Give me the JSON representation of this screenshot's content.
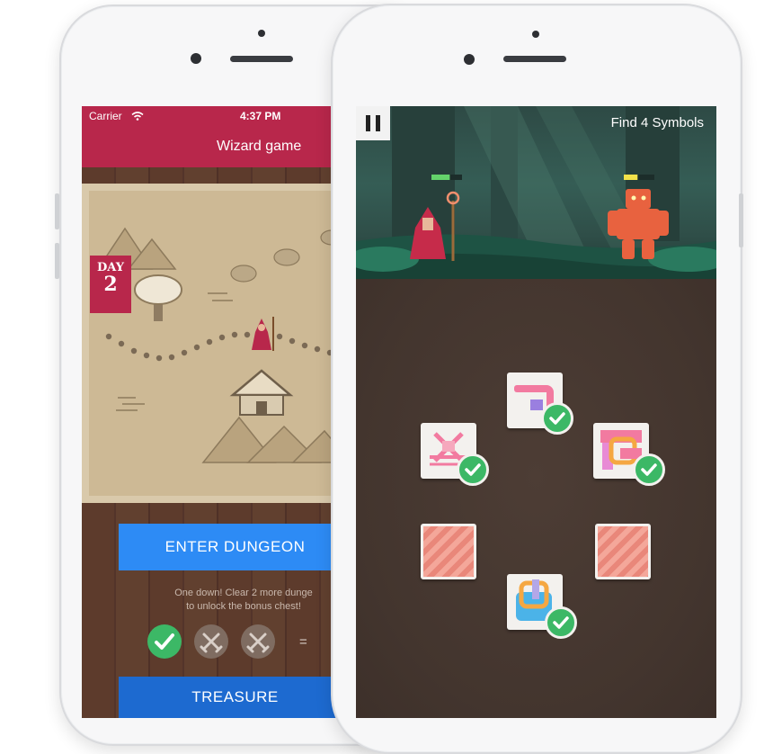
{
  "left_screen": {
    "status": {
      "carrier": "Carrier",
      "time": "4:37 PM"
    },
    "nav_title": "Wizard game",
    "day_badge": {
      "label": "DAY",
      "number": "2"
    },
    "enter_dungeon_label": "ENTER DUNGEON",
    "progress_text_line1": "One down! Clear 2 more dunge",
    "progress_text_line2": "to unlock the bonus chest!",
    "dungeon_badges": [
      {
        "icon": "checkmark-icon",
        "state": "cleared"
      },
      {
        "icon": "crossed-swords-icon",
        "state": "locked"
      },
      {
        "icon": "crossed-swords-icon",
        "state": "locked"
      }
    ],
    "equals_sign": "=",
    "treasure_label": "TREASURE",
    "colors": {
      "brand_red": "#b8274b",
      "enter_blue": "#2d8bf5",
      "treasure_blue": "#1d6ad0",
      "success_green": "#3cb866"
    }
  },
  "right_screen": {
    "objective_text": "Find 4 Symbols",
    "pause_icon": "pause-icon",
    "player_health": 0.6,
    "enemy_health": 0.45,
    "cards": [
      {
        "position": "top",
        "state": "matched",
        "icon": "pink-shapes-symbol-icon"
      },
      {
        "position": "upper-left",
        "state": "matched",
        "icon": "pink-crossed-symbol-icon"
      },
      {
        "position": "upper-right",
        "state": "matched",
        "icon": "pink-orange-knot-symbol-icon"
      },
      {
        "position": "lower-left",
        "state": "hidden",
        "icon": "striped-card-back-icon"
      },
      {
        "position": "lower-right",
        "state": "hidden",
        "icon": "striped-card-back-icon"
      },
      {
        "position": "bottom",
        "state": "matched",
        "icon": "blue-orange-symbol-icon"
      }
    ]
  }
}
